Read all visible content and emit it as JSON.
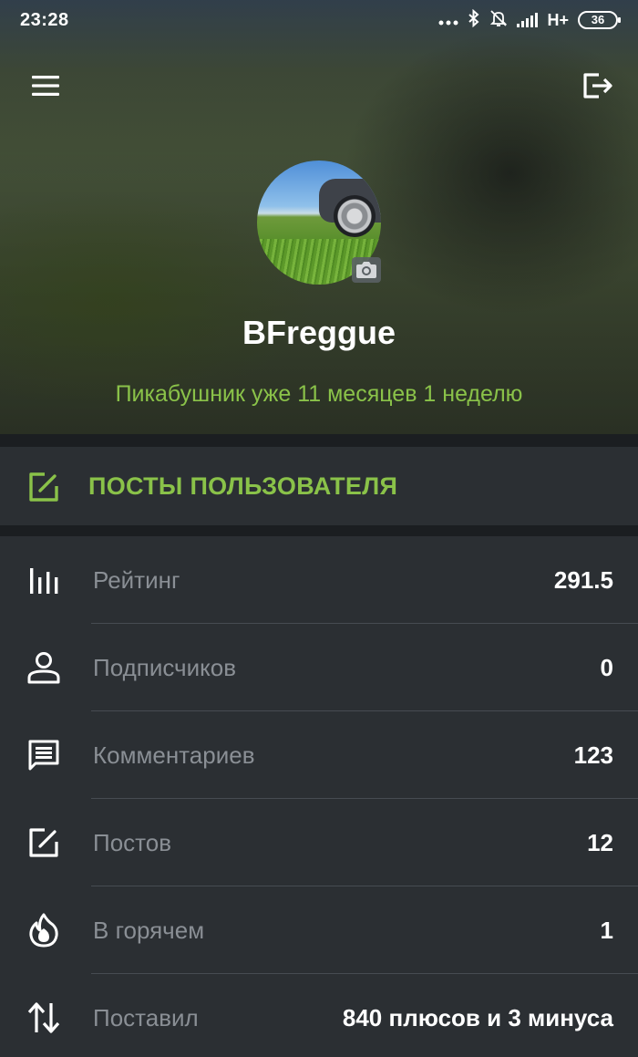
{
  "status_bar": {
    "time": "23:28",
    "icons": [
      "dots-icon",
      "bluetooth-icon",
      "bell-off-icon",
      "signal-icon"
    ],
    "network": "H+",
    "battery": "36"
  },
  "header": {
    "menu_icon": "hamburger-menu-icon",
    "logout_icon": "logout-icon",
    "username": "BFreggue",
    "membership": "Пикабушник уже 11 месяцев 1 неделю",
    "accent_color": "#8ac249"
  },
  "user_posts": {
    "label": "ПОСТЫ ПОЛЬЗОВАТЕЛЯ",
    "icon": "edit-icon"
  },
  "stats": [
    {
      "icon": "bar-chart-icon",
      "label": "Рейтинг",
      "value": "291.5"
    },
    {
      "icon": "person-icon",
      "label": "Подписчиков",
      "value": "0"
    },
    {
      "icon": "comment-icon",
      "label": "Комментариев",
      "value": "123"
    },
    {
      "icon": "edit-icon",
      "label": "Постов",
      "value": "12"
    },
    {
      "icon": "flame-icon",
      "label": "В горячем",
      "value": "1"
    },
    {
      "icon": "swap-vertical-icon",
      "label": "Поставил",
      "value": "840 плюсов и 3 минуса"
    }
  ],
  "colors": {
    "background": "#24282c",
    "panel": "#2b2f33",
    "label": "#8a8f95",
    "accent": "#8ac249"
  }
}
